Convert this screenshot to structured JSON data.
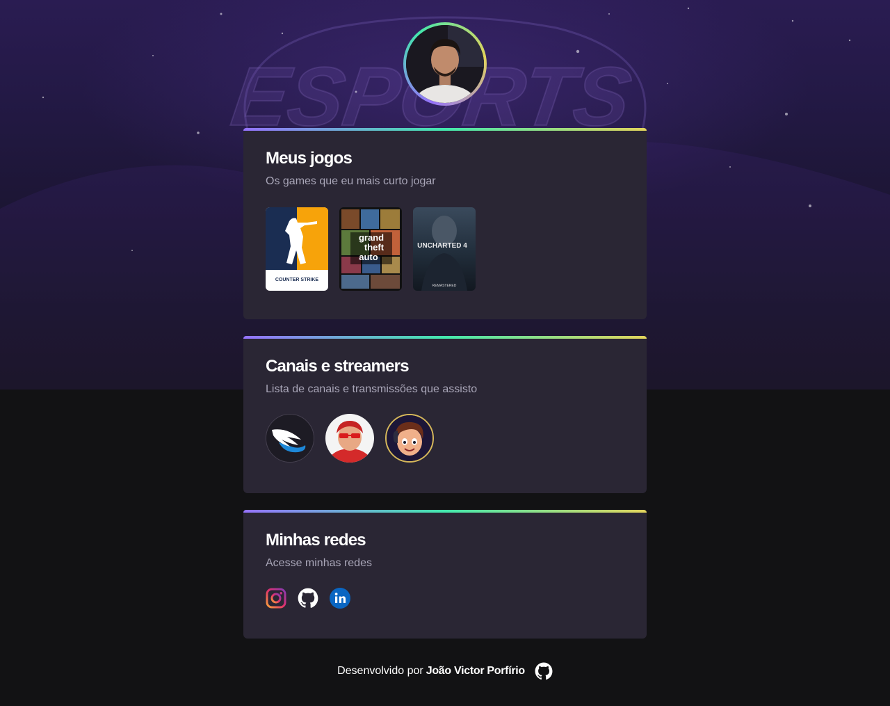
{
  "background": {
    "watermark_text": "ESPORTS"
  },
  "profile": {
    "avatar": "profile-photo"
  },
  "cards": {
    "games": {
      "title": "Meus jogos",
      "subtitle": "Os games que eu mais curto jogar",
      "items": [
        {
          "name": "Counter-Strike",
          "cover_text": "COUNTER STRIKE"
        },
        {
          "name": "Grand Theft Auto V",
          "cover_text_1": "grand",
          "cover_text_2": "theft",
          "cover_text_3": "auto"
        },
        {
          "name": "Uncharted 4",
          "cover_text": "UNCHARTED 4",
          "cover_sub": "REMASTERED"
        }
      ]
    },
    "channels": {
      "title": "Canais e streamers",
      "subtitle": "Lista de canais e transmissões que assisto"
    },
    "socials": {
      "title": "Minhas redes",
      "subtitle": "Acesse minhas redes",
      "items": [
        "instagram-icon",
        "github-icon",
        "linkedin-icon"
      ]
    }
  },
  "footer": {
    "prefix": "Desenvolvido por",
    "author": "João Victor Porfírio"
  },
  "colors": {
    "accent_purple": "#9572fc",
    "accent_green": "#43e7ad",
    "accent_yellow": "#e2d45c",
    "card_bg": "#2a2634",
    "page_bg": "#121214"
  }
}
